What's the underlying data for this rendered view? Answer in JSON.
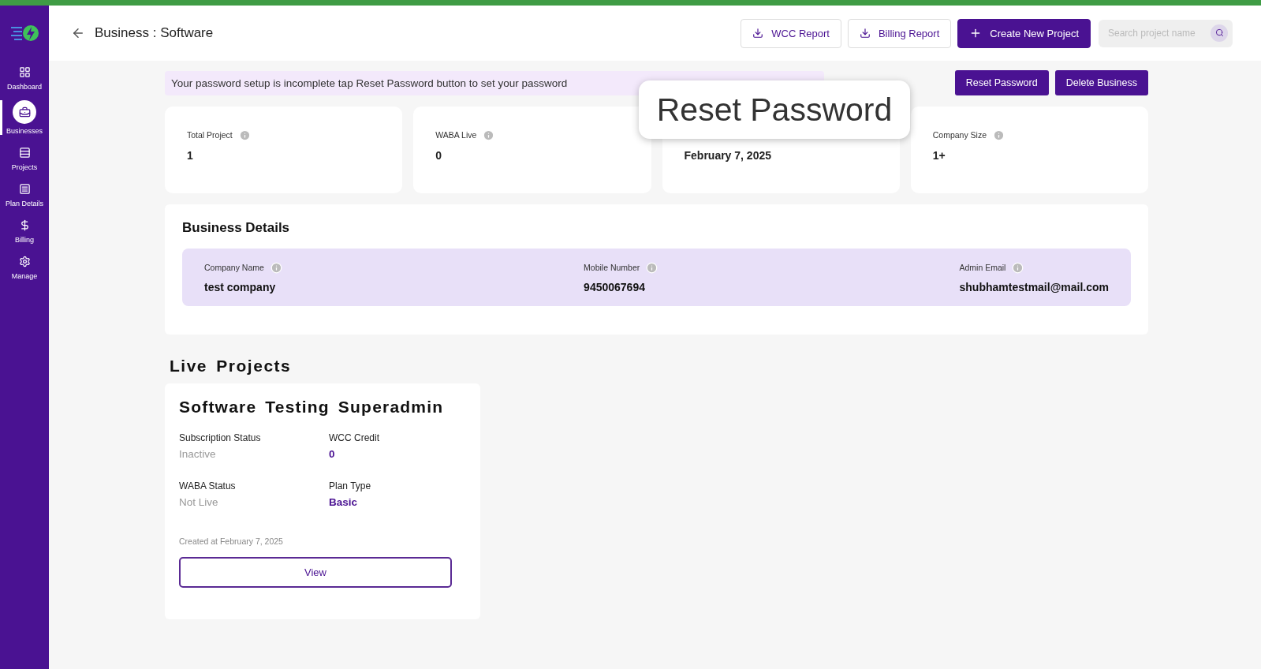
{
  "header": {
    "title": "Business : Software",
    "actions": [
      {
        "kind": "outline",
        "label": "WCC Report"
      },
      {
        "kind": "outline",
        "label": "Billing Report"
      },
      {
        "kind": "primary",
        "label": "Create New Project"
      }
    ],
    "search": {
      "placeholder": "Search project name"
    }
  },
  "sidebar": {
    "items": [
      {
        "label": "Dashboard",
        "selected": false
      },
      {
        "label": "Businesses",
        "selected": true
      },
      {
        "label": "Projects",
        "selected": false
      },
      {
        "label": "Plan Details",
        "selected": false
      },
      {
        "label": "Billing",
        "selected": false
      },
      {
        "label": "Manage",
        "selected": false
      }
    ]
  },
  "banner": {
    "text": "Your password setup is incomplete tap Reset Password button to set your password"
  },
  "business_actions": [
    "Reset Password",
    "Delete Business"
  ],
  "callout": {
    "text": "Reset Password"
  },
  "stats": [
    {
      "label": "Total Project",
      "value": "1"
    },
    {
      "label": "WABA Live",
      "value": "0"
    },
    {
      "value": "February 7, 2025"
    },
    {
      "label": "Company Size",
      "value": "1+"
    }
  ],
  "business_details": {
    "title": "Business Details",
    "fields": [
      {
        "label": "Company Name",
        "value": "test company"
      },
      {
        "label": "Mobile Number",
        "value": "9450067694"
      },
      {
        "label": "Admin Email",
        "value": "shubhamtestmail@mail.com"
      }
    ]
  },
  "live_projects": {
    "title": "Live Projects",
    "projects": [
      {
        "name": "Software Testing Superadmin",
        "fields": [
          {
            "label": "Subscription Status",
            "value": "Inactive",
            "kind": "muted"
          },
          {
            "label": "WCC Credit",
            "value": "0",
            "kind": "accent"
          },
          {
            "label": "WABA Status",
            "value": "Not Live",
            "kind": "muted"
          },
          {
            "label": "Plan Type",
            "value": "Basic",
            "kind": "accent"
          }
        ],
        "created": "Created at February 7, 2025",
        "button": "View"
      }
    ]
  }
}
